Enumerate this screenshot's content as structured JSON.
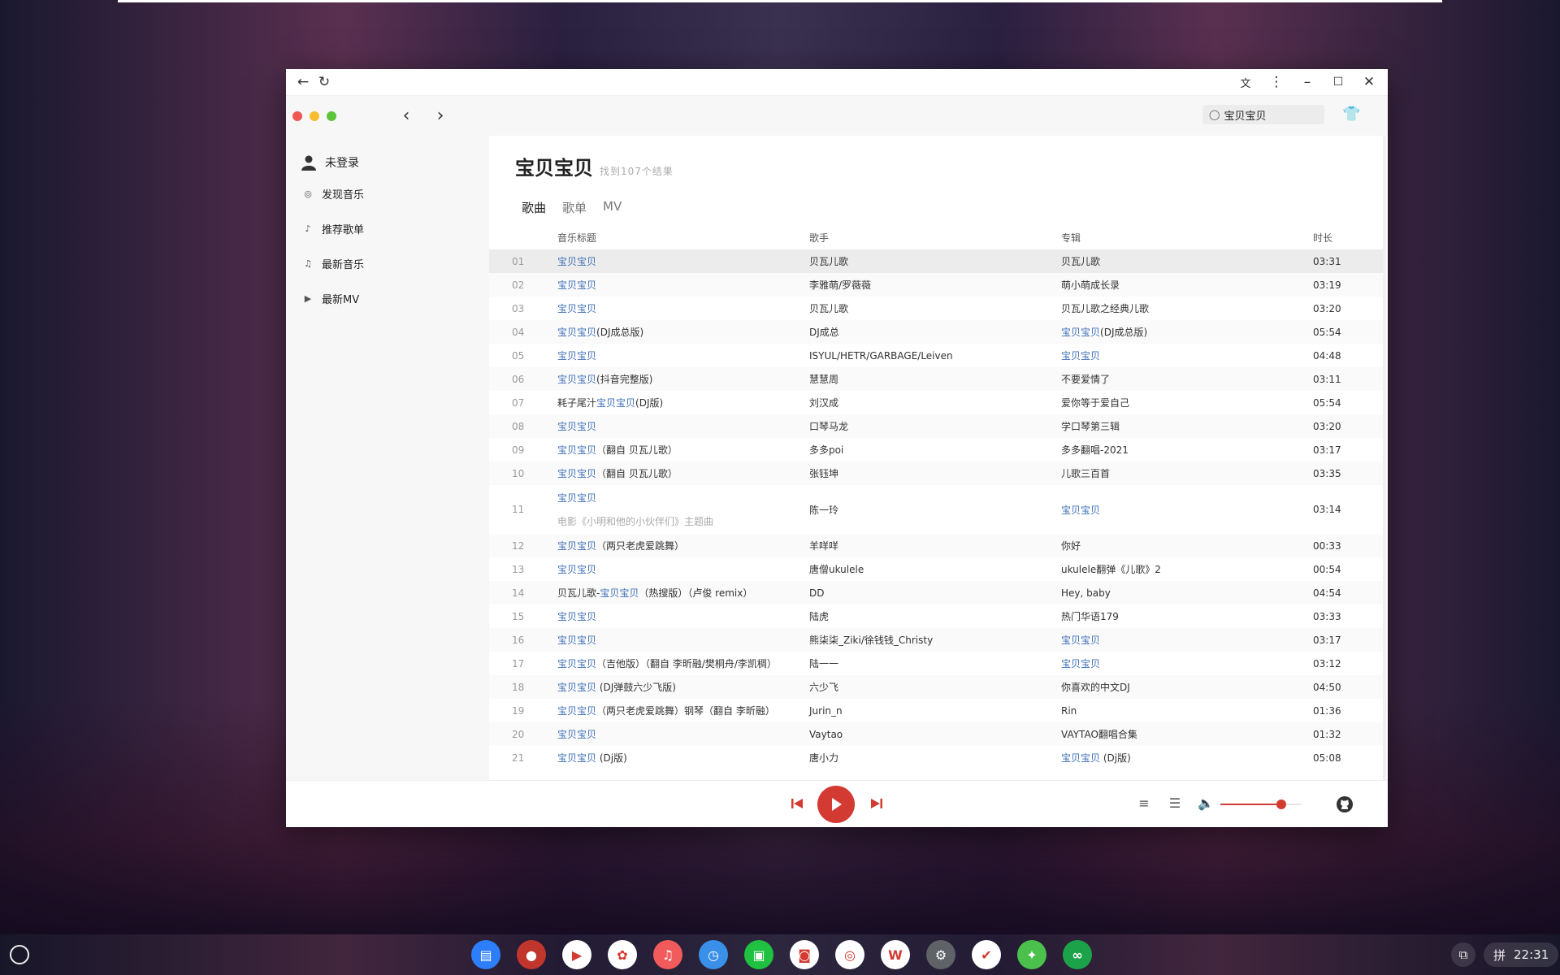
{
  "app": {
    "user_label": "未登录",
    "menu": [
      {
        "label": "发现音乐",
        "icon": "disc-icon"
      },
      {
        "label": "推荐歌单",
        "icon": "playlist-icon"
      },
      {
        "label": "最新音乐",
        "icon": "music-note-icon"
      },
      {
        "label": "最新MV",
        "icon": "video-icon"
      }
    ]
  },
  "search": {
    "value": "宝贝宝贝"
  },
  "result": {
    "keyword": "宝贝宝贝",
    "count_text": "找到107个结果"
  },
  "tabs": [
    "歌曲",
    "歌单",
    "MV"
  ],
  "table": {
    "headers": {
      "title": "音乐标题",
      "artist": "歌手",
      "album": "专辑",
      "duration": "时长"
    },
    "rows": [
      {
        "n": "01",
        "t_pre": "",
        "t_hl": "宝贝宝贝",
        "t_post": "",
        "sub": "",
        "artist": "贝瓦儿歌",
        "al_hl": "",
        "al_post": "贝瓦儿歌",
        "dur": "03:31"
      },
      {
        "n": "02",
        "t_pre": "",
        "t_hl": "宝贝宝贝",
        "t_post": "",
        "sub": "",
        "artist": "李雅萌/罗薇薇",
        "al_hl": "",
        "al_post": "萌小萌成长录",
        "dur": "03:19"
      },
      {
        "n": "03",
        "t_pre": "",
        "t_hl": "宝贝宝贝",
        "t_post": "",
        "sub": "",
        "artist": "贝瓦儿歌",
        "al_hl": "",
        "al_post": "贝瓦儿歌之经典儿歌",
        "dur": "03:20"
      },
      {
        "n": "04",
        "t_pre": "",
        "t_hl": "宝贝宝贝",
        "t_post": "(DJ成总版)",
        "sub": "",
        "artist": "DJ成总",
        "al_hl": "宝贝宝贝",
        "al_post": "(DJ成总版)",
        "dur": "05:54"
      },
      {
        "n": "05",
        "t_pre": "",
        "t_hl": "宝贝宝贝",
        "t_post": "",
        "sub": "",
        "artist": "ISYUL/HETR/GARBAGE/Leiven",
        "al_hl": "宝贝宝贝",
        "al_post": "",
        "dur": "04:48"
      },
      {
        "n": "06",
        "t_pre": "",
        "t_hl": "宝贝宝贝",
        "t_post": "(抖音完整版)",
        "sub": "",
        "artist": "慧慧周",
        "al_hl": "",
        "al_post": "不要爱情了",
        "dur": "03:11"
      },
      {
        "n": "07",
        "t_pre": "耗子尾汁",
        "t_hl": "宝贝宝贝",
        "t_post": "(DJ版)",
        "sub": "",
        "artist": "刘汉成",
        "al_hl": "",
        "al_post": "爱你等于爱自己",
        "dur": "05:54"
      },
      {
        "n": "08",
        "t_pre": "",
        "t_hl": "宝贝宝贝",
        "t_post": "",
        "sub": "",
        "artist": "口琴马龙",
        "al_hl": "",
        "al_post": "学口琴第三辑",
        "dur": "03:20"
      },
      {
        "n": "09",
        "t_pre": "",
        "t_hl": "宝贝宝贝",
        "t_post": "（翻自 贝瓦儿歌）",
        "sub": "",
        "artist": "多多poi",
        "al_hl": "",
        "al_post": "多多翻唱-2021",
        "dur": "03:17"
      },
      {
        "n": "10",
        "t_pre": "",
        "t_hl": "宝贝宝贝",
        "t_post": "（翻自 贝瓦儿歌）",
        "sub": "",
        "artist": "张钰坤",
        "al_hl": "",
        "al_post": "儿歌三百首",
        "dur": "03:35"
      },
      {
        "n": "11",
        "t_pre": "",
        "t_hl": "宝贝宝贝",
        "t_post": "",
        "sub": "电影《小明和他的小伙伴们》主题曲",
        "artist": "陈一玲",
        "al_hl": "宝贝宝贝",
        "al_post": "",
        "dur": "03:14"
      },
      {
        "n": "12",
        "t_pre": "",
        "t_hl": "宝贝宝贝",
        "t_post": "（两只老虎爱跳舞）",
        "sub": "",
        "artist": "羊咩咩",
        "al_hl": "",
        "al_post": "你好",
        "dur": "00:33"
      },
      {
        "n": "13",
        "t_pre": "",
        "t_hl": "宝贝宝贝",
        "t_post": "",
        "sub": "",
        "artist": "唐僧ukulele",
        "al_hl": "",
        "al_post": "ukulele翻弹《儿歌》2",
        "dur": "00:54"
      },
      {
        "n": "14",
        "t_pre": "贝瓦儿歌-",
        "t_hl": "宝贝宝贝",
        "t_post": "（热搜版）（卢俊 remix）",
        "sub": "",
        "artist": "DD",
        "al_hl": "",
        "al_post": "Hey, baby",
        "dur": "04:54"
      },
      {
        "n": "15",
        "t_pre": "",
        "t_hl": "宝贝宝贝",
        "t_post": "",
        "sub": "",
        "artist": "陆虎",
        "al_hl": "",
        "al_post": "热门华语179",
        "dur": "03:33"
      },
      {
        "n": "16",
        "t_pre": "",
        "t_hl": "宝贝宝贝",
        "t_post": "",
        "sub": "",
        "artist": "熊柒柒_Ziki/徐钱钱_Christy",
        "al_hl": "宝贝宝贝",
        "al_post": "",
        "dur": "03:17"
      },
      {
        "n": "17",
        "t_pre": "",
        "t_hl": "宝贝宝贝",
        "t_post": "（吉他版）（翻自 李昕融/樊桐舟/李凯稠）",
        "sub": "",
        "artist": "陆一一",
        "al_hl": "宝贝宝贝",
        "al_post": "",
        "dur": "03:12"
      },
      {
        "n": "18",
        "t_pre": "",
        "t_hl": "宝贝宝贝",
        "t_post": " (DJ弹鼓六少飞版)",
        "sub": "",
        "artist": "六少飞",
        "al_hl": "",
        "al_post": "你喜欢的中文DJ",
        "dur": "04:50"
      },
      {
        "n": "19",
        "t_pre": "",
        "t_hl": "宝贝宝贝",
        "t_post": "（两只老虎爱跳舞）钢琴（翻自 李昕融）",
        "sub": "",
        "artist": "Jurin_n",
        "al_hl": "",
        "al_post": "Rin",
        "dur": "01:36"
      },
      {
        "n": "20",
        "t_pre": "",
        "t_hl": "宝贝宝贝",
        "t_post": "",
        "sub": "",
        "artist": "Vaytao",
        "al_hl": "",
        "al_post": "VAYTAO翻唱合集",
        "dur": "01:32"
      },
      {
        "n": "21",
        "t_pre": "",
        "t_hl": "宝贝宝贝",
        "t_post": " (Dj版)",
        "sub": "",
        "artist": "唐小力",
        "al_hl": "宝贝宝贝",
        "al_post": " (Dj版)",
        "dur": "05:08"
      }
    ]
  },
  "player": {
    "volume_fraction": 0.75
  },
  "shelf": {
    "apps": [
      {
        "name": "files-app-icon",
        "color": "#2d7ff9",
        "glyph": "▤"
      },
      {
        "name": "chrome-app-icon",
        "color": "#c0362c",
        "glyph": "●"
      },
      {
        "name": "play-store-icon",
        "color": "#ffffff",
        "glyph": "▶"
      },
      {
        "name": "baidu-icon",
        "color": "#ffffff",
        "glyph": "✿"
      },
      {
        "name": "music-app-icon",
        "color": "#f25b5b",
        "glyph": "♫"
      },
      {
        "name": "clock-app-icon",
        "color": "#3a8fe8",
        "glyph": "◷"
      },
      {
        "name": "iqiyi-icon",
        "color": "#20c040",
        "glyph": "▣"
      },
      {
        "name": "shopping-bag-icon",
        "color": "#ffffff",
        "glyph": "◙"
      },
      {
        "name": "camera-app-icon",
        "color": "#ffffff",
        "glyph": "◎"
      },
      {
        "name": "wps-icon",
        "color": "#ffffff",
        "glyph": "W"
      },
      {
        "name": "settings-icon",
        "color": "#5f6368",
        "glyph": "⚙"
      },
      {
        "name": "tasks-icon",
        "color": "#ffffff",
        "glyph": "✔"
      },
      {
        "name": "game-app-icon",
        "color": "#4cc04c",
        "glyph": "✦"
      },
      {
        "name": "chat-app-icon",
        "color": "#1ca34a",
        "glyph": "∞"
      }
    ],
    "ime": "拼",
    "time": "22:31"
  }
}
